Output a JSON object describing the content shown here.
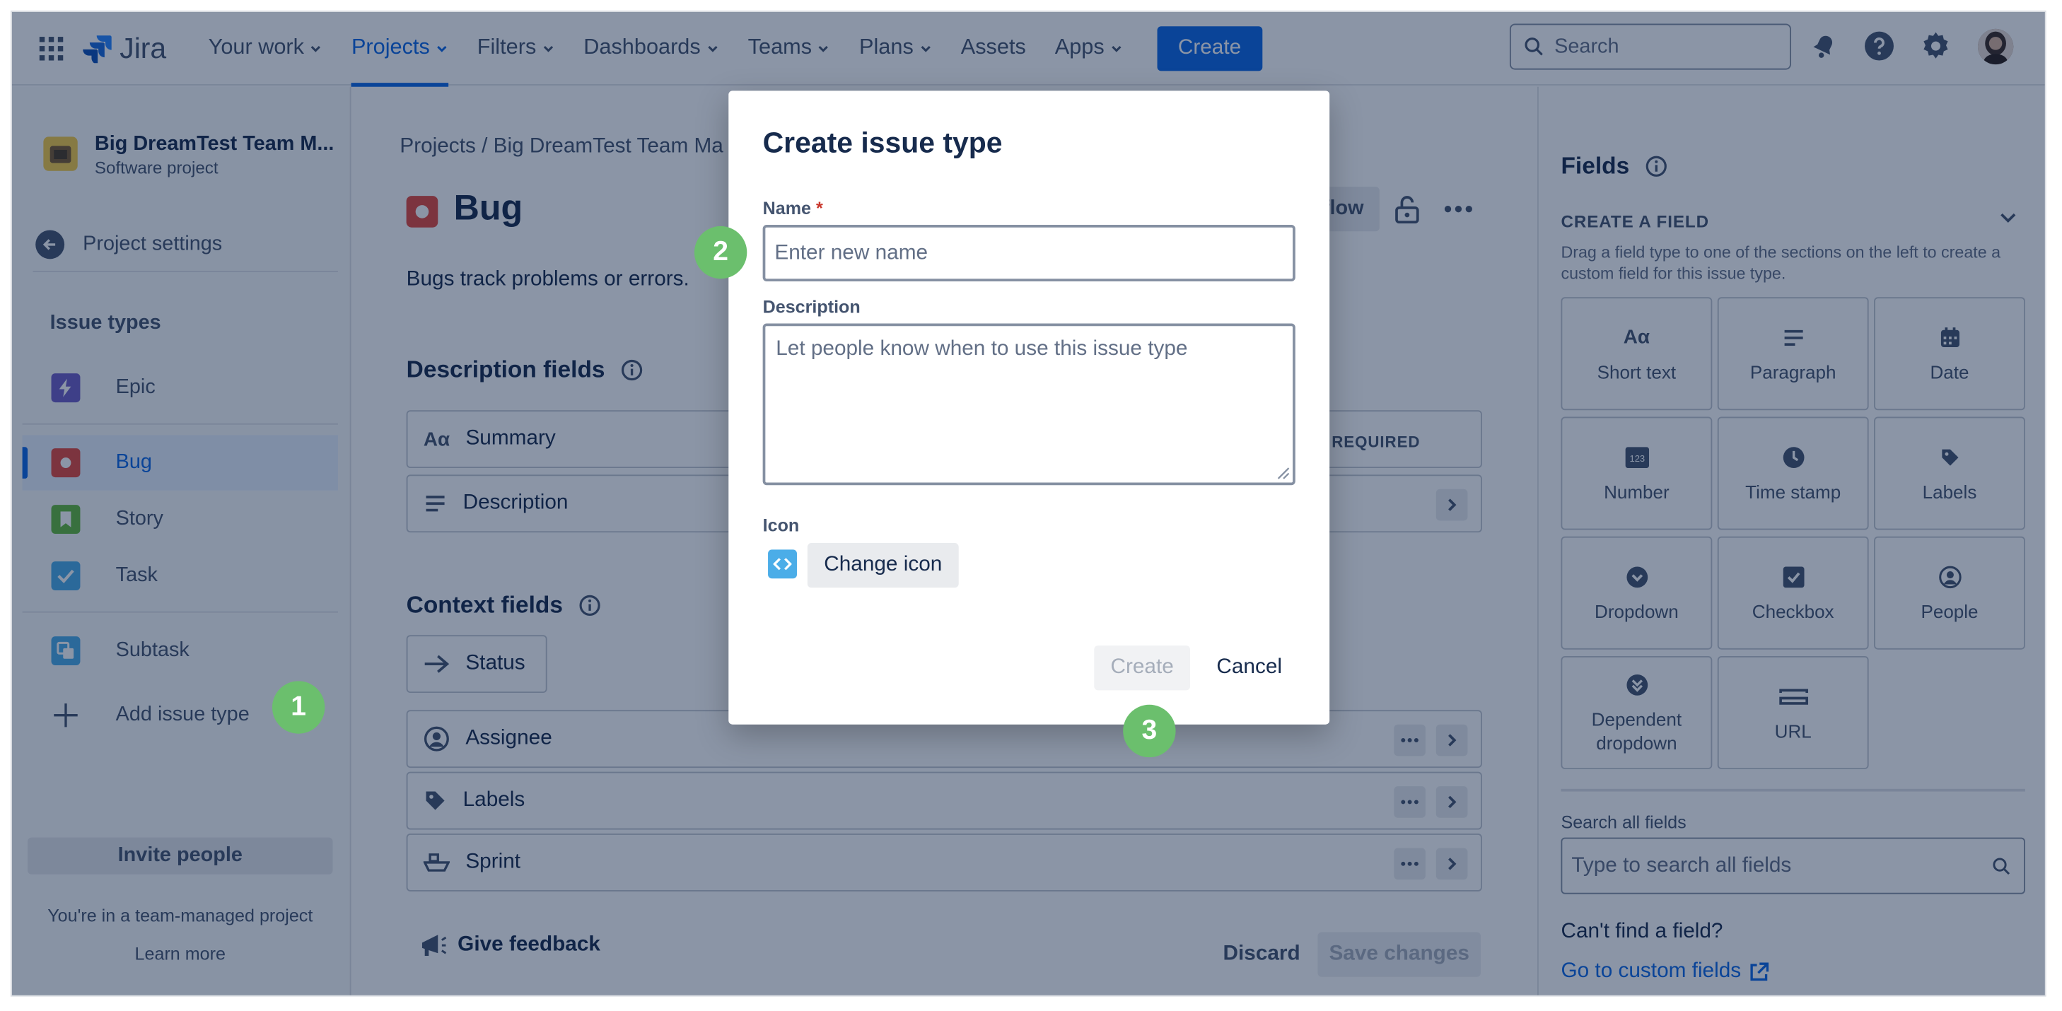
{
  "app": {
    "name": "Jira"
  },
  "nav": {
    "items": [
      "Your work",
      "Projects",
      "Filters",
      "Dashboards",
      "Teams",
      "Plans",
      "Assets",
      "Apps"
    ],
    "create": "Create",
    "search_placeholder": "Search"
  },
  "sidebar": {
    "project_name": "Big DreamTest Team M...",
    "project_type": "Software project",
    "settings": "Project settings",
    "heading": "Issue types",
    "items": [
      {
        "label": "Epic",
        "icon": "epic-icon",
        "color": "#6e5dc6"
      },
      {
        "label": "Bug",
        "icon": "bug-icon",
        "color": "#e2483d"
      },
      {
        "label": "Story",
        "icon": "story-icon",
        "color": "#63ba3c"
      },
      {
        "label": "Task",
        "icon": "task-icon",
        "color": "#4bade8"
      },
      {
        "label": "Subtask",
        "icon": "subtask-icon",
        "color": "#4bade8"
      }
    ],
    "add": "Add issue type",
    "invite": "Invite people",
    "team_note": "You're in a team-managed project",
    "learn_more": "Learn more"
  },
  "main": {
    "breadcrumb": "Projects  /  Big DreamTest Team Ma",
    "title": "Bug",
    "description": "Bugs track problems or errors.",
    "workflow_fragment": "flow",
    "description_fields": {
      "heading": "Description fields",
      "rows": [
        {
          "label": "Summary",
          "tag": "REQUIRED"
        },
        {
          "label": "Description"
        }
      ]
    },
    "context_fields": {
      "heading": "Context fields",
      "status": "Status",
      "rows": [
        "Assignee",
        "Labels",
        "Sprint"
      ]
    },
    "feedback": "Give feedback",
    "discard": "Discard",
    "save": "Save changes"
  },
  "fields_panel": {
    "heading": "Fields",
    "create_heading": "CREATE A FIELD",
    "create_desc": "Drag a field type to one of the sections on the left to create a custom field for this issue type.",
    "tiles": [
      {
        "label": "Short text",
        "icon": "short-text-icon"
      },
      {
        "label": "Paragraph",
        "icon": "paragraph-icon"
      },
      {
        "label": "Date",
        "icon": "calendar-icon"
      },
      {
        "label": "Number",
        "icon": "number-icon"
      },
      {
        "label": "Time stamp",
        "icon": "clock-icon"
      },
      {
        "label": "Labels",
        "icon": "tag-icon"
      },
      {
        "label": "Dropdown",
        "icon": "dropdown-icon"
      },
      {
        "label": "Checkbox",
        "icon": "checkbox-icon"
      },
      {
        "label": "People",
        "icon": "person-icon"
      },
      {
        "label": "Dependent dropdown",
        "icon": "dependent-dropdown-icon"
      },
      {
        "label": "URL",
        "icon": "link-icon"
      }
    ],
    "search_label": "Search all fields",
    "search_placeholder": "Type to search all fields",
    "cant_find": "Can't find a field?",
    "custom_link": "Go to custom fields"
  },
  "modal": {
    "title": "Create issue type",
    "name_label": "Name",
    "name_required": "*",
    "name_placeholder": "Enter new name",
    "desc_label": "Description",
    "desc_placeholder": "Let people know when to use this issue type",
    "icon_label": "Icon",
    "change_icon": "Change icon",
    "create": "Create",
    "cancel": "Cancel"
  },
  "badges": [
    "1",
    "2",
    "3"
  ],
  "colors": {
    "accent": "#0c66e4",
    "badge": "#6bbf6d",
    "overlay": "rgba(9,30,66,0.47)"
  }
}
